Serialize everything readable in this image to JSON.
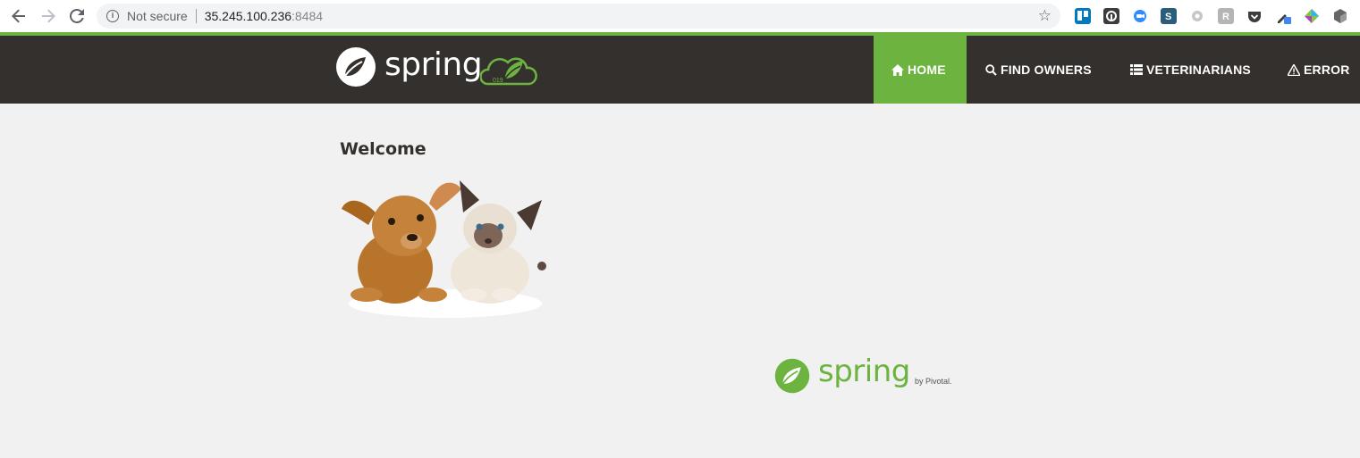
{
  "browser": {
    "security_label": "Not secure",
    "url_host": "35.245.100.236",
    "url_port": ":8484"
  },
  "navbar": {
    "brand_text": "spring",
    "brand_badge": "019",
    "items": [
      {
        "label": "Home",
        "icon": "home-icon",
        "active": true
      },
      {
        "label": "Find owners",
        "icon": "search-icon",
        "active": false
      },
      {
        "label": "Veterinarians",
        "icon": "list-icon",
        "active": false
      },
      {
        "label": "Error",
        "icon": "warning-icon",
        "active": false
      }
    ]
  },
  "main": {
    "heading": "Welcome",
    "image_name": "pets-image"
  },
  "footer": {
    "logo_text": "spring",
    "logo_byline": "by Pivotal."
  },
  "colors": {
    "brand_green": "#6db33f",
    "navbar_bg": "#34302d",
    "page_bg": "#f1f1f1"
  }
}
